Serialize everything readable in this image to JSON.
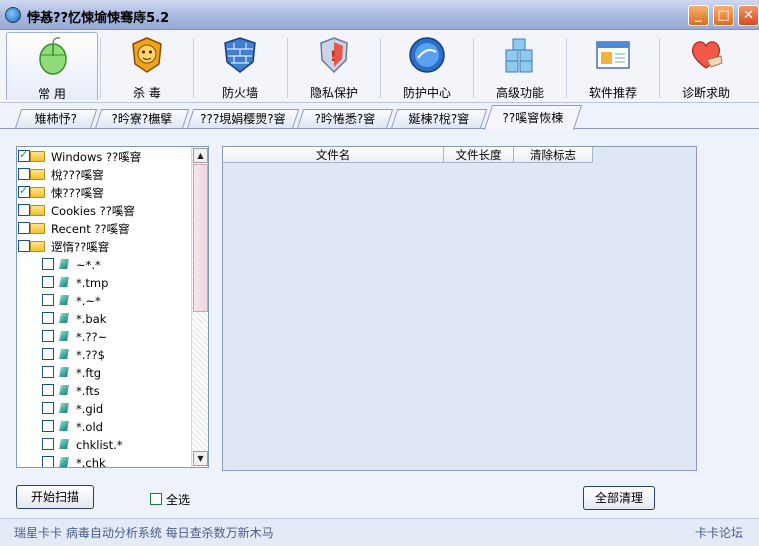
{
  "window": {
    "title": "悖惎??忆悚堬悚骞庤5.2",
    "controls": [
      "minimize",
      "maximize",
      "close"
    ]
  },
  "toolbar": {
    "items": [
      {
        "label": "常 用",
        "icon": "mouse-icon",
        "active": true
      },
      {
        "label": "杀 毒",
        "icon": "lion-icon"
      },
      {
        "label": "防火墙",
        "icon": "firewall-icon"
      },
      {
        "label": "隐私保护",
        "icon": "privacy-shield-icon"
      },
      {
        "label": "防护中心",
        "icon": "protection-globe-icon"
      },
      {
        "label": "高级功能",
        "icon": "cubes-icon"
      },
      {
        "label": "软件推荐",
        "icon": "software-window-icon"
      },
      {
        "label": "诊断求助",
        "icon": "heart-hand-icon"
      }
    ]
  },
  "tabs": [
    {
      "label": "雉柿忬?"
    },
    {
      "label": "?昑寮?橅擘"
    },
    {
      "label": "???垷娟樱煛?窨"
    },
    {
      "label": "?昑惓悉?窨"
    },
    {
      "label": "娫楝?梲?窨"
    },
    {
      "label": "??嗘窨恢楝",
      "active": true
    }
  ],
  "tree": {
    "items": [
      {
        "text": "Windows ??嗘窨",
        "type": "folder",
        "checked": true
      },
      {
        "text": "梲???嗘窨",
        "type": "folder",
        "checked": false
      },
      {
        "text": "悚???嗘窨",
        "type": "folder",
        "checked": true
      },
      {
        "text": "Cookies ??嗘窨",
        "type": "folder",
        "checked": false
      },
      {
        "text": "Recent ??嗘窨",
        "type": "folder",
        "checked": false
      },
      {
        "text": "遻惰??嗘窨",
        "type": "folder",
        "checked": false
      },
      {
        "text": "~*.*",
        "type": "file",
        "checked": false
      },
      {
        "text": "*.tmp",
        "type": "file",
        "checked": false
      },
      {
        "text": "*.~*",
        "type": "file",
        "checked": false
      },
      {
        "text": "*.bak",
        "type": "file",
        "checked": false
      },
      {
        "text": "*.??~",
        "type": "file",
        "checked": false
      },
      {
        "text": "*.??$",
        "type": "file",
        "checked": false
      },
      {
        "text": "*.ftg",
        "type": "file",
        "checked": false
      },
      {
        "text": "*.fts",
        "type": "file",
        "checked": false
      },
      {
        "text": "*.gid",
        "type": "file",
        "checked": false
      },
      {
        "text": "*.old",
        "type": "file",
        "checked": false
      },
      {
        "text": "chklist.*",
        "type": "file",
        "checked": false
      },
      {
        "text": "*.chk",
        "type": "file",
        "checked": false
      }
    ]
  },
  "table": {
    "columns": [
      "文件名",
      "文件长度",
      "清除标志"
    ],
    "rows": []
  },
  "buttons": {
    "scan": "开始扫描",
    "select_all": "全选",
    "clean_all": "全部清理"
  },
  "statusbar": {
    "left": "瑞星卡卡  病毒自动分析系统  每日查杀数万新木马",
    "right": "卡卡论坛"
  }
}
